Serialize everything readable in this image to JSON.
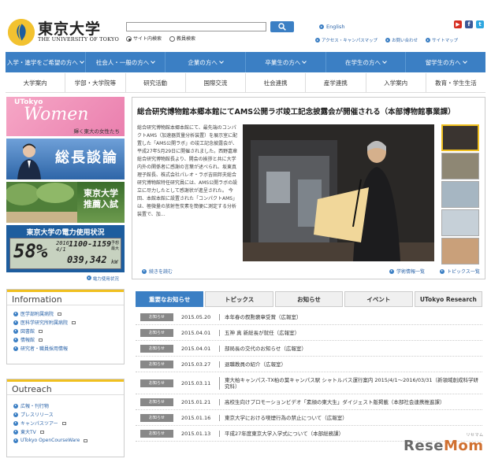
{
  "header": {
    "logo_title": "東京大学",
    "logo_sub": "THE UNIVERSITY OF TOKYO",
    "search_placeholder": "",
    "radio_site": "サイト内検索",
    "radio_faculty": "教員検索",
    "lang": "English",
    "sub_links": [
      "アクセス・キャンパスマップ",
      "お問い合わせ",
      "サイトマップ"
    ],
    "social": [
      {
        "icon": "youtube-icon",
        "glyph": "▶",
        "color": "#d62d20"
      },
      {
        "icon": "facebook-icon",
        "glyph": "f",
        "color": "#3b5998"
      },
      {
        "icon": "twitter-icon",
        "glyph": "t",
        "color": "#2ea7e0"
      }
    ]
  },
  "mainnav": [
    "入学・進学をご希望の方へ",
    "社会人・一般の方へ",
    "企業の方へ",
    "卒業生の方へ",
    "在学生の方へ",
    "留学生の方へ"
  ],
  "subnav": [
    "大学案内",
    "学部・大学院等",
    "研究活動",
    "国際交流",
    "社会連携",
    "産学連携",
    "入学案内",
    "教育・学生生活"
  ],
  "banners": {
    "women_top": "UTokyo",
    "women_main": "Women",
    "women_sub": "輝く東大の女性たち",
    "president": "総長談論",
    "recommend": [
      "東京大学",
      "推薦入試"
    ],
    "power_head": "東京大学の電力使用状況",
    "power_pct": "58%",
    "power_year": "2016",
    "power_date": "4/1",
    "power_time": "1100-1159",
    "power_forecast": "予想",
    "power_max": "最大",
    "power_value": "039,342",
    "power_unit": "kW",
    "power_link": "電力使用状況"
  },
  "information": {
    "title": "Information",
    "items": [
      "医学部附属病院",
      "医科学研究所附属病院",
      "図書館",
      "情報館",
      "研究者・職員採用情報"
    ]
  },
  "outreach": {
    "title": "Outreach",
    "items": [
      "広報・刊行物",
      "プレスリリース",
      "キャンパスツアー",
      "東大TV",
      "UTokyo OpenCourseWare"
    ]
  },
  "feature": {
    "title": "総合研究博物館本郷本館にてAMS公開ラボ竣工記念披露会が開催される（本部博物館事業課）",
    "body": "総合研究博物館本郷本館にて、最先端のコンパクトAMS（加速器質量分析装置）を展示室に配置した「AMS公開ラボ」の竣工記念披露会が、平成27年5月29日に開催されました。西野嘉章総合研究博物館長より、開会の挨拶と共に大学内外の関係者に感謝の言葉が述べられ、坂東真理子館長、株式会社パレオ・ラボ吉田邦夫総合研究博物館特任研究員には、AMS公開ラボの設立に尽力したとして感謝状が進呈された。 今回、本館本館に設置された「コンパクトAMS」は、極微量の放射性炭素を簡便に測定する分析装置で、加…",
    "read_more": "続きを読む",
    "list_link": "学術情報一覧",
    "topics_link": "トピックス一覧"
  },
  "tabs": [
    "重要なお知らせ",
    "トピックス",
    "お知らせ",
    "イベント",
    "UTokyo Research"
  ],
  "news": [
    {
      "badge": "お知らせ",
      "date": "2015.05.20",
      "text": "本年春の叙勲褒章受賞（広報室）"
    },
    {
      "badge": "お知らせ",
      "date": "2015.04.01",
      "text": "五神 真 新総長が就任（広報室）"
    },
    {
      "badge": "お知らせ",
      "date": "2015.04.01",
      "text": "部局長の交代のお知らせ（広報室）"
    },
    {
      "badge": "お知らせ",
      "date": "2015.03.27",
      "text": "退職教員の紹介（広報室）"
    },
    {
      "badge": "お知らせ",
      "date": "2015.03.11",
      "text": "東大柏キャンパス-TX柏の葉キャンパス駅 シャトルバス運行案内 2015/4/1～2016/03/31（新領域創成科学研究科）"
    },
    {
      "badge": "お知らせ",
      "date": "2015.01.21",
      "text": "高校生向けプロモーションビデオ「素顔の東大生」ダイジェスト版掲載（本部社会連携推進課）"
    },
    {
      "badge": "お知らせ",
      "date": "2015.01.16",
      "text": "東京大学における喫煙行為の禁止について（広報室）"
    },
    {
      "badge": "お知らせ",
      "date": "2015.01.13",
      "text": "平成27年度東京大学入学式について（本部総務課）"
    }
  ],
  "watermark": {
    "a": "Rese",
    "b": "Mom",
    "ruby": "リセマム"
  }
}
